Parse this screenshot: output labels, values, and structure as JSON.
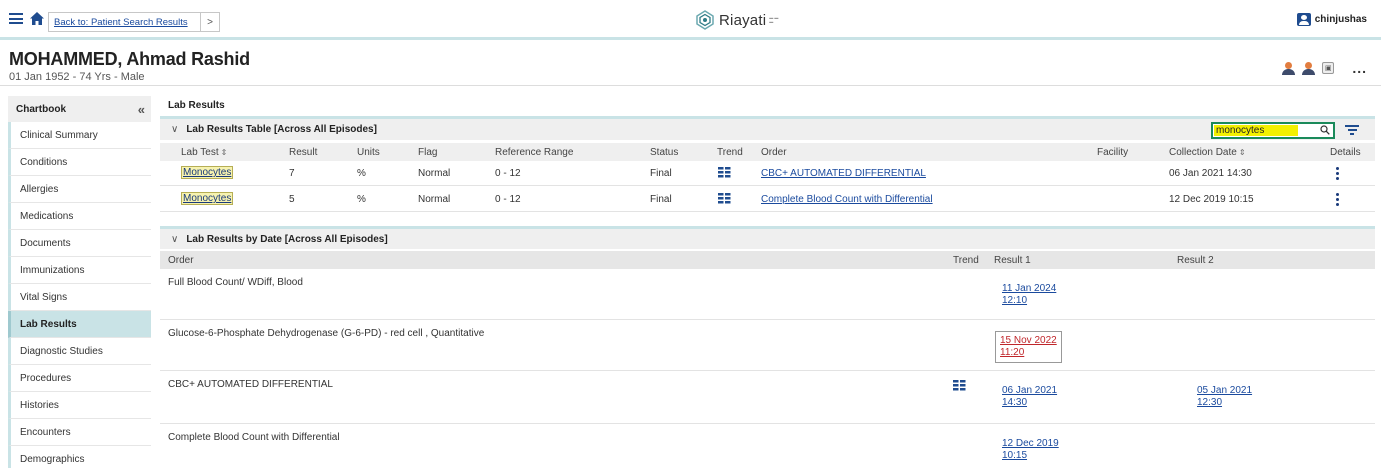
{
  "topbar": {
    "back_label": "Back to: Patient Search Results",
    "next_glyph": ">",
    "brand": "Riayati",
    "user": "chinjushas"
  },
  "patient": {
    "name": "MOHAMMED, Ahmad Rashid",
    "info": "01 Jan 1952 - 74 Yrs - Male",
    "more": "..."
  },
  "sidebar": {
    "title": "Chartbook",
    "collapse": "«",
    "items": [
      {
        "label": "Clinical Summary"
      },
      {
        "label": "Conditions"
      },
      {
        "label": "Allergies"
      },
      {
        "label": "Medications"
      },
      {
        "label": "Documents"
      },
      {
        "label": "Immunizations"
      },
      {
        "label": "Vital Signs"
      },
      {
        "label": "Lab Results",
        "active": true
      },
      {
        "label": "Diagnostic Studies"
      },
      {
        "label": "Procedures"
      },
      {
        "label": "Histories"
      },
      {
        "label": "Encounters"
      },
      {
        "label": "Demographics"
      }
    ]
  },
  "main": {
    "title": "Lab Results",
    "table": {
      "title": "Lab Results Table [Across All Episodes]",
      "search_value": "monocytes",
      "columns": {
        "lab_test": "Lab Test",
        "result": "Result",
        "units": "Units",
        "flag": "Flag",
        "reference": "Reference Range",
        "status": "Status",
        "trend": "Trend",
        "order": "Order",
        "facility": "Facility",
        "collection": "Collection Date",
        "details": "Details"
      },
      "rows": [
        {
          "lab_test": "Monocytes",
          "result": "7",
          "units": "%",
          "flag": "Normal",
          "reference": "0 - 12",
          "status": "Final",
          "order": "CBC+ AUTOMATED DIFFERENTIAL",
          "facility": "",
          "collection": "06 Jan 2021 14:30"
        },
        {
          "lab_test": "Monocytes",
          "result": "5",
          "units": "%",
          "flag": "Normal",
          "reference": "0 - 12",
          "status": "Final",
          "order": "Complete Blood Count with Differential",
          "facility": "",
          "collection": "12 Dec 2019 10:15"
        }
      ]
    },
    "bydate": {
      "title": "Lab Results by Date [Across All Episodes]",
      "columns": {
        "order": "Order",
        "trend": "Trend",
        "result1": "Result 1",
        "result2": "Result 2"
      },
      "rows": [
        {
          "order": "Full Blood Count/ WDiff, Blood",
          "trend": false,
          "r1_date": "11 Jan 2024",
          "r1_time": "12:10",
          "r1_abnormal": false,
          "r2_date": "",
          "r2_time": ""
        },
        {
          "order": "Glucose-6-Phosphate Dehydrogenase (G-6-PD) - red cell , Quantitative",
          "trend": false,
          "r1_date": "15 Nov 2022",
          "r1_time": "11:20",
          "r1_abnormal": true,
          "r2_date": "",
          "r2_time": ""
        },
        {
          "order": "CBC+ AUTOMATED DIFFERENTIAL",
          "trend": true,
          "r1_date": "06 Jan 2021",
          "r1_time": "14:30",
          "r1_abnormal": false,
          "r2_date": "05 Jan 2021",
          "r2_time": "12:30"
        },
        {
          "order": "Complete Blood Count with Differential",
          "trend": false,
          "r1_date": "12 Dec 2019",
          "r1_time": "10:15",
          "r1_abnormal": false,
          "r2_date": "",
          "r2_time": ""
        }
      ]
    }
  },
  "colors": {
    "accent": "#c9e3e6",
    "brand_blue": "#1f4c8f",
    "link": "#1a4a9e",
    "abnormal": "#c0262b",
    "search_border": "#1a8a5a",
    "search_highlight": "#f3f000"
  }
}
